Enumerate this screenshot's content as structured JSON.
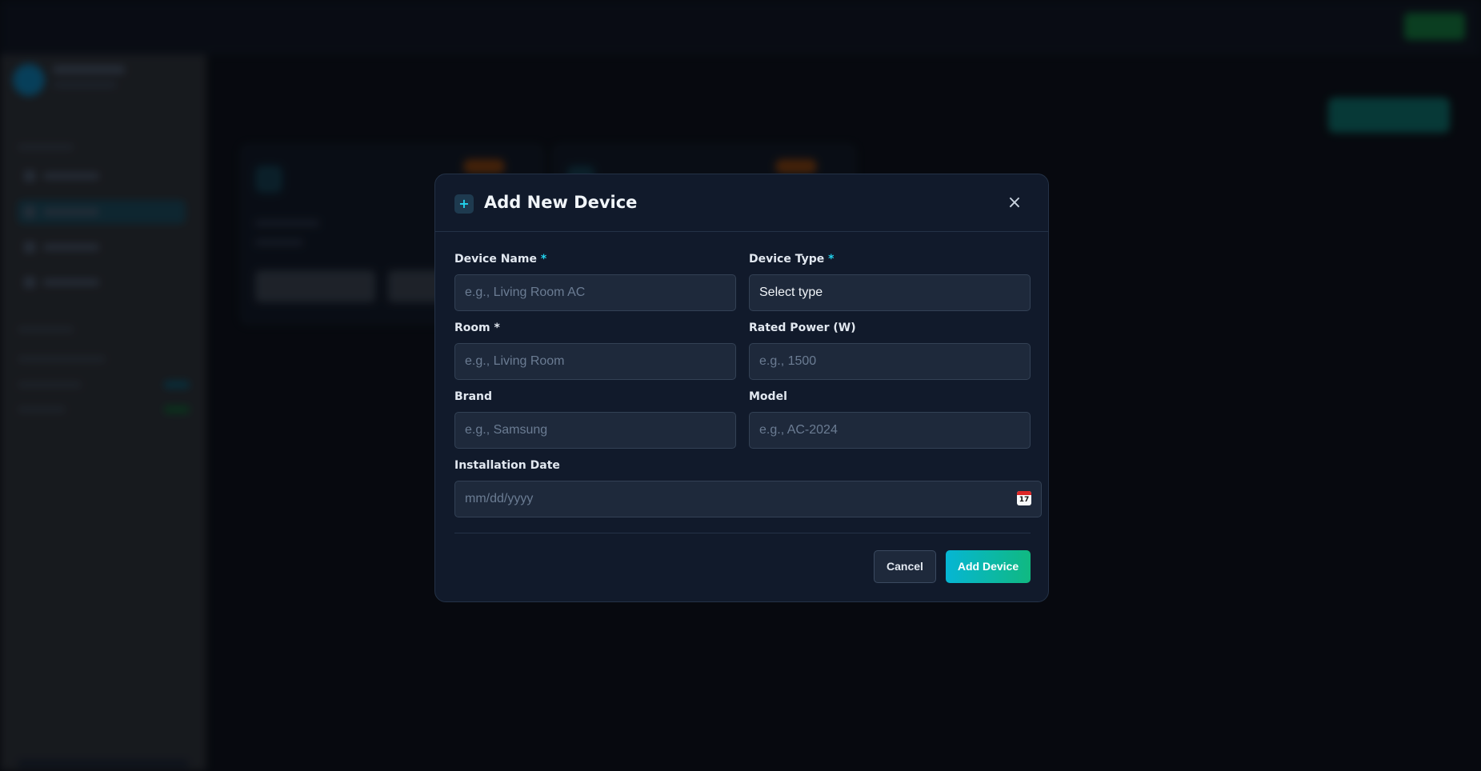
{
  "modal": {
    "icon": "plus-icon",
    "icon_glyph": "+",
    "title": "Add New Device",
    "close_glyph": "×",
    "fields": {
      "device_name": {
        "label": "Device Name",
        "required_mark": "*",
        "placeholder": "e.g., Living Room AC"
      },
      "device_type": {
        "label": "Device Type",
        "required_mark": "*",
        "value": "Select type"
      },
      "room": {
        "label": "Room *",
        "placeholder": "e.g., Living Room"
      },
      "rated_power": {
        "label": "Rated Power (W)",
        "placeholder": "e.g., 1500"
      },
      "brand": {
        "label": "Brand",
        "placeholder": "e.g., Samsung"
      },
      "model": {
        "label": "Model",
        "placeholder": "e.g., AC-2024"
      },
      "installation_date": {
        "label": "Installation Date",
        "placeholder": "mm/dd/yyyy",
        "icon": "calendar-icon",
        "icon_number": "17"
      }
    },
    "buttons": {
      "cancel": "Cancel",
      "add": "Add Device"
    }
  },
  "colors": {
    "accent": "#22d3ee",
    "add_button_gradient_start": "#06b6d4",
    "add_button_gradient_end": "#10b981",
    "modal_bg": "#111a2b",
    "input_bg": "#1e293b"
  }
}
